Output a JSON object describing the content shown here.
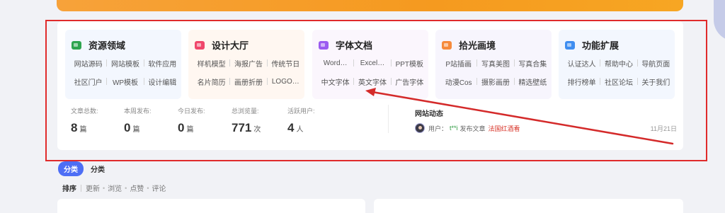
{
  "categories": [
    {
      "title": "资源领域",
      "icon": "flag-icon",
      "color": "#2ea44f",
      "bg": "#f3f7fe",
      "links": [
        [
          "网站源码",
          "网站模板",
          "软件应用"
        ],
        [
          "社区门户",
          "WP模板",
          "设计编辑"
        ]
      ]
    },
    {
      "title": "设计大厅",
      "icon": "palette-icon",
      "color": "#f0476b",
      "bg": "#fff7f1",
      "links": [
        [
          "样机模型",
          "海报广告",
          "传统节日"
        ],
        [
          "名片简历",
          "画册折册",
          "LOGO…"
        ]
      ]
    },
    {
      "title": "字体文档",
      "icon": "font-icon",
      "color": "#9b5cf0",
      "bg": "#fbf6fd",
      "links": [
        [
          "Word…",
          "Excel…",
          "PPT模板"
        ],
        [
          "中文字体",
          "英文字体",
          "广告字体"
        ]
      ]
    },
    {
      "title": "拾光画境",
      "icon": "brush-icon",
      "color": "#f68a3c",
      "bg": "#f7f5fd",
      "links": [
        [
          "P站插画",
          "写真美图",
          "写真合集"
        ],
        [
          "动漫Cos",
          "摄影画册",
          "精选壁纸"
        ]
      ]
    },
    {
      "title": "功能扩展",
      "icon": "cloud-icon",
      "color": "#3f8ef0",
      "bg": "#f3f7fe",
      "links": [
        [
          "认证达人",
          "帮助中心",
          "导航页面"
        ],
        [
          "排行榜单",
          "社区论坛",
          "关于我们"
        ]
      ]
    }
  ],
  "stats": [
    {
      "label": "文章总数:",
      "value": "8",
      "unit": "篇"
    },
    {
      "label": "本周发布:",
      "value": "0",
      "unit": "篇"
    },
    {
      "label": "今日发布:",
      "value": "0",
      "unit": "篇"
    },
    {
      "label": "总浏览量:",
      "value": "771",
      "unit": "次"
    },
    {
      "label": "活跃用户:",
      "value": "4",
      "unit": "人"
    }
  ],
  "activity": {
    "title": "网站动态",
    "user_label": "用户：",
    "user": "t**i",
    "action": "发布文章",
    "post": "法国红酒看",
    "date": "11月21日"
  },
  "tabs": {
    "active": "分类",
    "other": "分类"
  },
  "sort": {
    "label": "排序",
    "options": [
      "更新",
      "浏览",
      "点赞",
      "评论"
    ]
  },
  "colors": {
    "accent": "#4d6ef5",
    "annotation": "#e02b2b",
    "banner": "#f59a1f"
  }
}
